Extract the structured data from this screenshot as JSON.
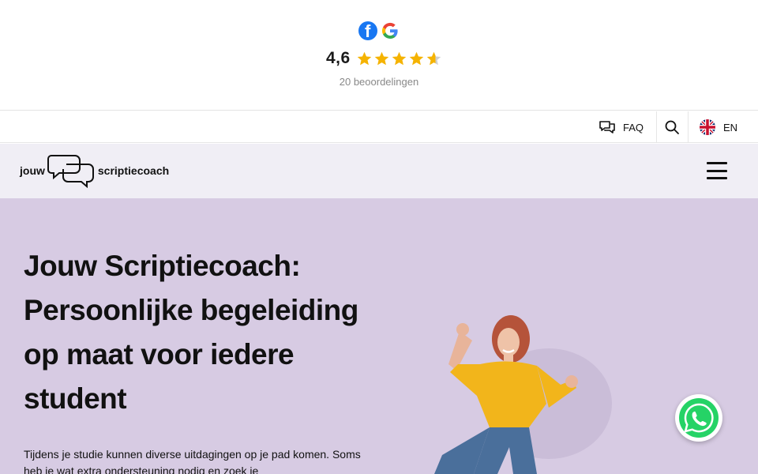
{
  "rating": {
    "score": "4,6",
    "stars": 4.6,
    "count_text": "20 beoordelingen",
    "sources": [
      "facebook-icon",
      "google-icon"
    ]
  },
  "utility": {
    "faq_label": "FAQ",
    "lang_label": "EN"
  },
  "nav": {
    "logo_left": "jouw",
    "logo_right": "scriptiecoach"
  },
  "hero": {
    "title": "Jouw Scriptiecoach: Persoonlijke begeleiding op maat voor iedere student",
    "intro": "Tijdens je studie kunnen diverse uitdagingen op je pad komen. Soms heb je wat extra ondersteuning nodig en zoek je"
  },
  "colors": {
    "hero_bg": "#d7cbe3",
    "nav_bg": "#f0eef5",
    "star": "#f5b301",
    "whatsapp": "#25d366"
  }
}
